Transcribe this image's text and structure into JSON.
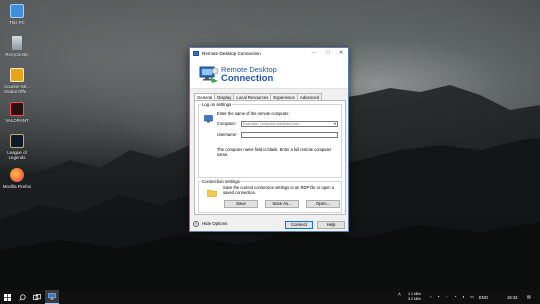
{
  "desktop": {
    "icons": [
      {
        "label": "This PC",
        "icon": "computer-icon"
      },
      {
        "label": "Recycle Bin",
        "icon": "recycle-bin-icon"
      },
      {
        "label": "Counter-Str... Global Offe...",
        "icon": "csgo-icon"
      },
      {
        "label": "VALORANT",
        "icon": "valorant-icon"
      },
      {
        "label": "League of Legends",
        "icon": "league-icon"
      },
      {
        "label": "Mozilla Firefox",
        "icon": "firefox-icon"
      }
    ]
  },
  "window": {
    "title": "Remote Desktop Connection",
    "banner_line1": "Remote Desktop",
    "banner_line2": "Connection",
    "tabs": [
      "General",
      "Display",
      "Local Resources",
      "Experience",
      "Advanced"
    ],
    "active_tab": "General",
    "logon": {
      "group_title": "Log on settings",
      "intro": "Enter the name of the remote computer.",
      "computer_label": "Computer:",
      "computer_placeholder": "Example: computer.fabrikam.com",
      "username_label": "Username:",
      "username_value": "",
      "blank_note": "The computer name field is blank. Enter a full remote computer name."
    },
    "connection": {
      "group_title": "Connection settings",
      "description": "Save the current connection settings to an RDP file or open a saved connection.",
      "save_label": "Save",
      "save_as_label": "Save As...",
      "open_label": "Open..."
    },
    "hide_options_label": "Hide Options",
    "connect_label": "Connect",
    "help_label": "Help"
  },
  "taskbar": {
    "network_up": "1.1 kB/s",
    "network_down": "3.2 kB/s",
    "language": "ENG",
    "time": "16:42"
  },
  "colors": {
    "accent": "#0078d7",
    "banner_text": "#1e5aa8",
    "taskbar": "#101010"
  }
}
